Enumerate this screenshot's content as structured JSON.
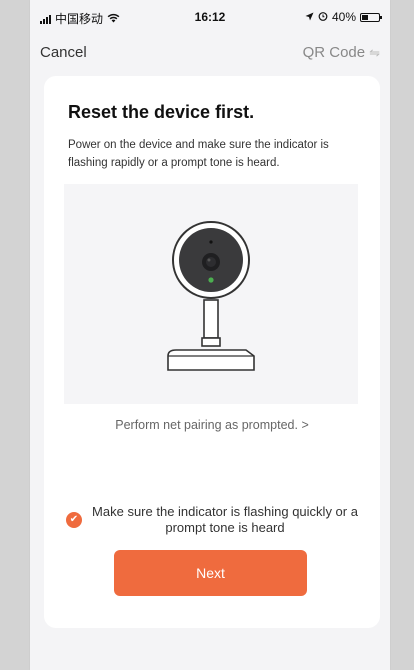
{
  "status_bar": {
    "carrier": "中国移动",
    "time": "16:12",
    "battery": "40%",
    "battery_level": 0.4,
    "icons": [
      "signal-icon",
      "wifi-icon",
      "location-icon",
      "alarm-icon",
      "battery-icon"
    ]
  },
  "nav": {
    "cancel_label": "Cancel",
    "qr_label": "QR Code",
    "qr_icon": "swap-icon"
  },
  "card": {
    "title": "Reset the device first.",
    "description": "Power on the device and make sure the indicator is flashing rapidly or a prompt tone is heard.",
    "illustration": "camera-illustration",
    "link_label": "Perform net pairing as prompted. >",
    "confirm_label": "Make sure the indicator is flashing quickly or a prompt tone is heard",
    "confirm_checked": true,
    "next_label": "Next"
  },
  "colors": {
    "accent": "#ef6b3e",
    "background": "#f4f4f6",
    "card": "#ffffff",
    "indicator_led": "#4caf50"
  }
}
